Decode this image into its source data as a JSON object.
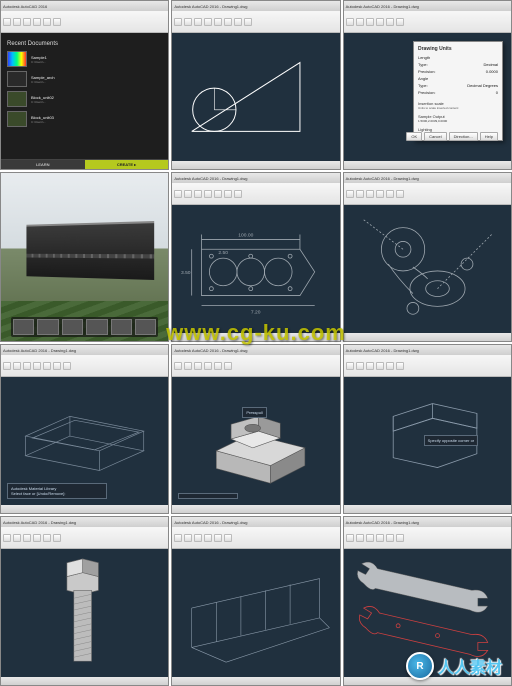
{
  "watermark_url": "www.cg-ku.com",
  "watermark_label": "人人素材",
  "watermark_badge": "R",
  "tiles": {
    "t1": {
      "title": "Autodesk AutoCAD 2016",
      "recent_header": "Recent Documents",
      "items": [
        {
          "name": "Sample1",
          "sub": "C:\\Users\\..."
        },
        {
          "name": "Sample_arch",
          "sub": "C:\\Users\\..."
        },
        {
          "name": "Block_unit02",
          "sub": "C:\\Users\\..."
        },
        {
          "name": "Block_unit03",
          "sub": "C:\\Users\\..."
        }
      ],
      "learn": "LEARN",
      "create": "CREATE ▸"
    },
    "t2": {
      "title": "Autodesk AutoCAD 2016 - Drawing1.dwg"
    },
    "t3": {
      "title": "Autodesk AutoCAD 2016 - Drawing1.dwg",
      "dialog_title": "Drawing Units",
      "rows": [
        {
          "l": "Length",
          "v": ""
        },
        {
          "l": "Type:",
          "v": "Decimal"
        },
        {
          "l": "Precision:",
          "v": "0.0000"
        },
        {
          "l": "Angle",
          "v": ""
        },
        {
          "l": "Type:",
          "v": "Decimal Degrees"
        },
        {
          "l": "Precision:",
          "v": "0"
        }
      ],
      "section2": "Insertion scale",
      "section2_sub": "Units to scale inserted content:",
      "section3": "Sample Output",
      "sample": "1.5000,2.0039,0.0000",
      "section4": "Lighting",
      "section4_sub": "Units for specifying the intensity of lighting:",
      "btns": {
        "ok": "OK",
        "cancel": "Cancel",
        "dir": "Direction...",
        "help": "Help"
      }
    },
    "t5": {
      "title": "Autodesk AutoCAD 2016 - Drawing1.dwg",
      "dims": {
        "a": "100.00",
        "b": "7.20",
        "c": "2.50",
        "d": "3.50"
      }
    },
    "t6": {
      "title": "Autodesk AutoCAD 2016 - Drawing1.dwg"
    },
    "t7": {
      "title": "Autodesk AutoCAD 2016 - Drawing1.dwg",
      "hint1": "Autodesk Material Library",
      "hint2": "Select face or [Undo/Remove]:"
    },
    "t8": {
      "title": "Autodesk AutoCAD 2016 - Drawing1.dwg",
      "tooltip": "Presspull"
    },
    "t9": {
      "title": "Autodesk AutoCAD 2016 - Drawing1.dwg",
      "tooltip": "Specify opposite corner or"
    },
    "t10": {
      "title": "Autodesk AutoCAD 2016 - Drawing1.dwg"
    },
    "t11": {
      "title": "Autodesk AutoCAD 2016 - Drawing1.dwg"
    },
    "t12": {
      "title": "Autodesk AutoCAD 2016 - Drawing1.dwg"
    }
  }
}
